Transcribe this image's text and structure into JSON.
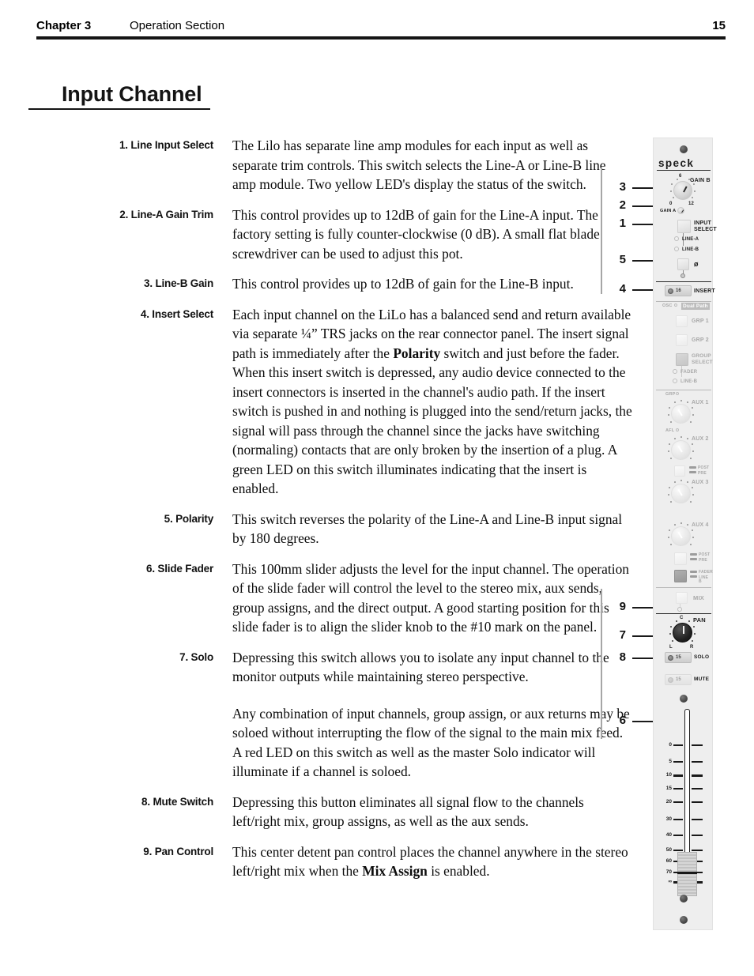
{
  "header": {
    "chapter": "Chapter 3",
    "section": "Operation Section",
    "page_number": "15"
  },
  "title": "Input Channel",
  "sections": [
    {
      "label": "1. Line Input Select",
      "paragraphs": [
        "The Lilo has separate line amp modules for each input as well as separate trim controls. This switch selects the Line-A or Line-B line amp module. Two yellow LED's display the status of the switch."
      ]
    },
    {
      "label": "2. Line-A Gain Trim",
      "paragraphs": [
        "This control provides up to 12dB of gain for the Line-A input. The factory setting is fully counter-clockwise (0 dB). A small flat blade screwdriver can be used to adjust this pot."
      ]
    },
    {
      "label": "3. Line-B Gain",
      "paragraphs": [
        "This control provides up to 12dB of gain for the Line-B input."
      ]
    },
    {
      "label": "4. Insert Select",
      "paragraphs": [
        "Each input channel on the LiLo has a balanced send and return available via separate ¼” TRS jacks on the rear connector panel. The insert signal path is immediately after the <b>Polarity</b> switch and just before the fader. When this insert switch is depressed, any audio device connected to the insert connectors is inserted in the channel's audio path. If the insert switch is pushed in and nothing is plugged into the send/return jacks, the signal will pass through the channel since the jacks have switching (normaling) contacts that are only broken by the insertion of a plug.  A green LED on this switch illuminates indicating that the insert is enabled."
      ]
    },
    {
      "label": "5. Polarity",
      "paragraphs": [
        "This switch reverses the polarity of the Line-A and Line-B input signal by 180 degrees."
      ]
    },
    {
      "label": "6. Slide Fader",
      "paragraphs": [
        "This 100mm slider adjusts the level for the input channel. The operation of the slide fader will control the level to the stereo mix, aux sends, group assigns, and the direct output. A good starting position for this slide fader is to align the slider knob to the #10 mark on the panel."
      ]
    },
    {
      "label": "7. Solo",
      "paragraphs": [
        "Depressing this switch allows you to isolate any input channel to the monitor outputs while maintaining stereo perspective.",
        "Any combination of input channels, group assign, or aux returns may be soloed without interrupting the flow of the signal to the main mix feed.  A red LED on this switch as well as the master Solo indicator will illuminate if a channel is soloed."
      ]
    },
    {
      "label": "8. Mute Switch",
      "paragraphs": [
        "Depressing this button eliminates all signal flow to the channels left/right mix, group assigns, as well as the aux sends."
      ]
    },
    {
      "label": "9. Pan Control",
      "paragraphs": [
        "This center detent pan control places the channel anywhere in the stereo left/right mix when the <b>Mix Assign</b> is enabled."
      ]
    }
  ],
  "callouts": [
    {
      "number": "3"
    },
    {
      "number": "2"
    },
    {
      "number": "1"
    },
    {
      "number": "5"
    },
    {
      "number": "4"
    },
    {
      "number": "9"
    },
    {
      "number": "7"
    },
    {
      "number": "8"
    },
    {
      "number": "6"
    }
  ],
  "panel": {
    "brand": "speck",
    "labels": {
      "gain_b": "GAIN B",
      "gain_b_min": "0",
      "gain_b_mid": "6",
      "gain_b_max": "12",
      "gain_a": "GAIN A",
      "input_select_l1": "INPUT",
      "input_select_l2": "SELECT",
      "line_a": "LINE-A",
      "line_b": "LINE-B",
      "polarity": "ø",
      "insert": "INSERT",
      "insert_num": "16",
      "osc": "OSC",
      "dual_path": "Dual Path",
      "grp1": "GRP 1",
      "grp2": "GRP 2",
      "group_select_l1": "GROUP",
      "group_select_l2": "SELECT",
      "fader": "FADER",
      "line_b2": "LINE-B",
      "grp": "GRP",
      "aux1": "AUX 1",
      "afl": "AFL",
      "aux2": "AUX 2",
      "post": "POST",
      "pre": "PRE",
      "aux3": "AUX 3",
      "aux4": "AUX 4",
      "post2": "POST",
      "pre2": "PRE",
      "fader2": "FADER",
      "line_b3": "LINE B",
      "mix": "MIX",
      "pan": "PAN",
      "pan_c": "C",
      "pan_l": "L",
      "pan_r": "R",
      "solo": "SOLO",
      "solo_num": "15",
      "mute": "MUTE",
      "mute_num": "15"
    },
    "fader_scale": [
      "0",
      "5",
      "10",
      "15",
      "20",
      "30",
      "40",
      "50",
      "60",
      "70",
      "∞"
    ]
  },
  "colors": {
    "panel_bg": "#eeeeee",
    "ink": "#111111",
    "leader": "#a6a6a6"
  }
}
